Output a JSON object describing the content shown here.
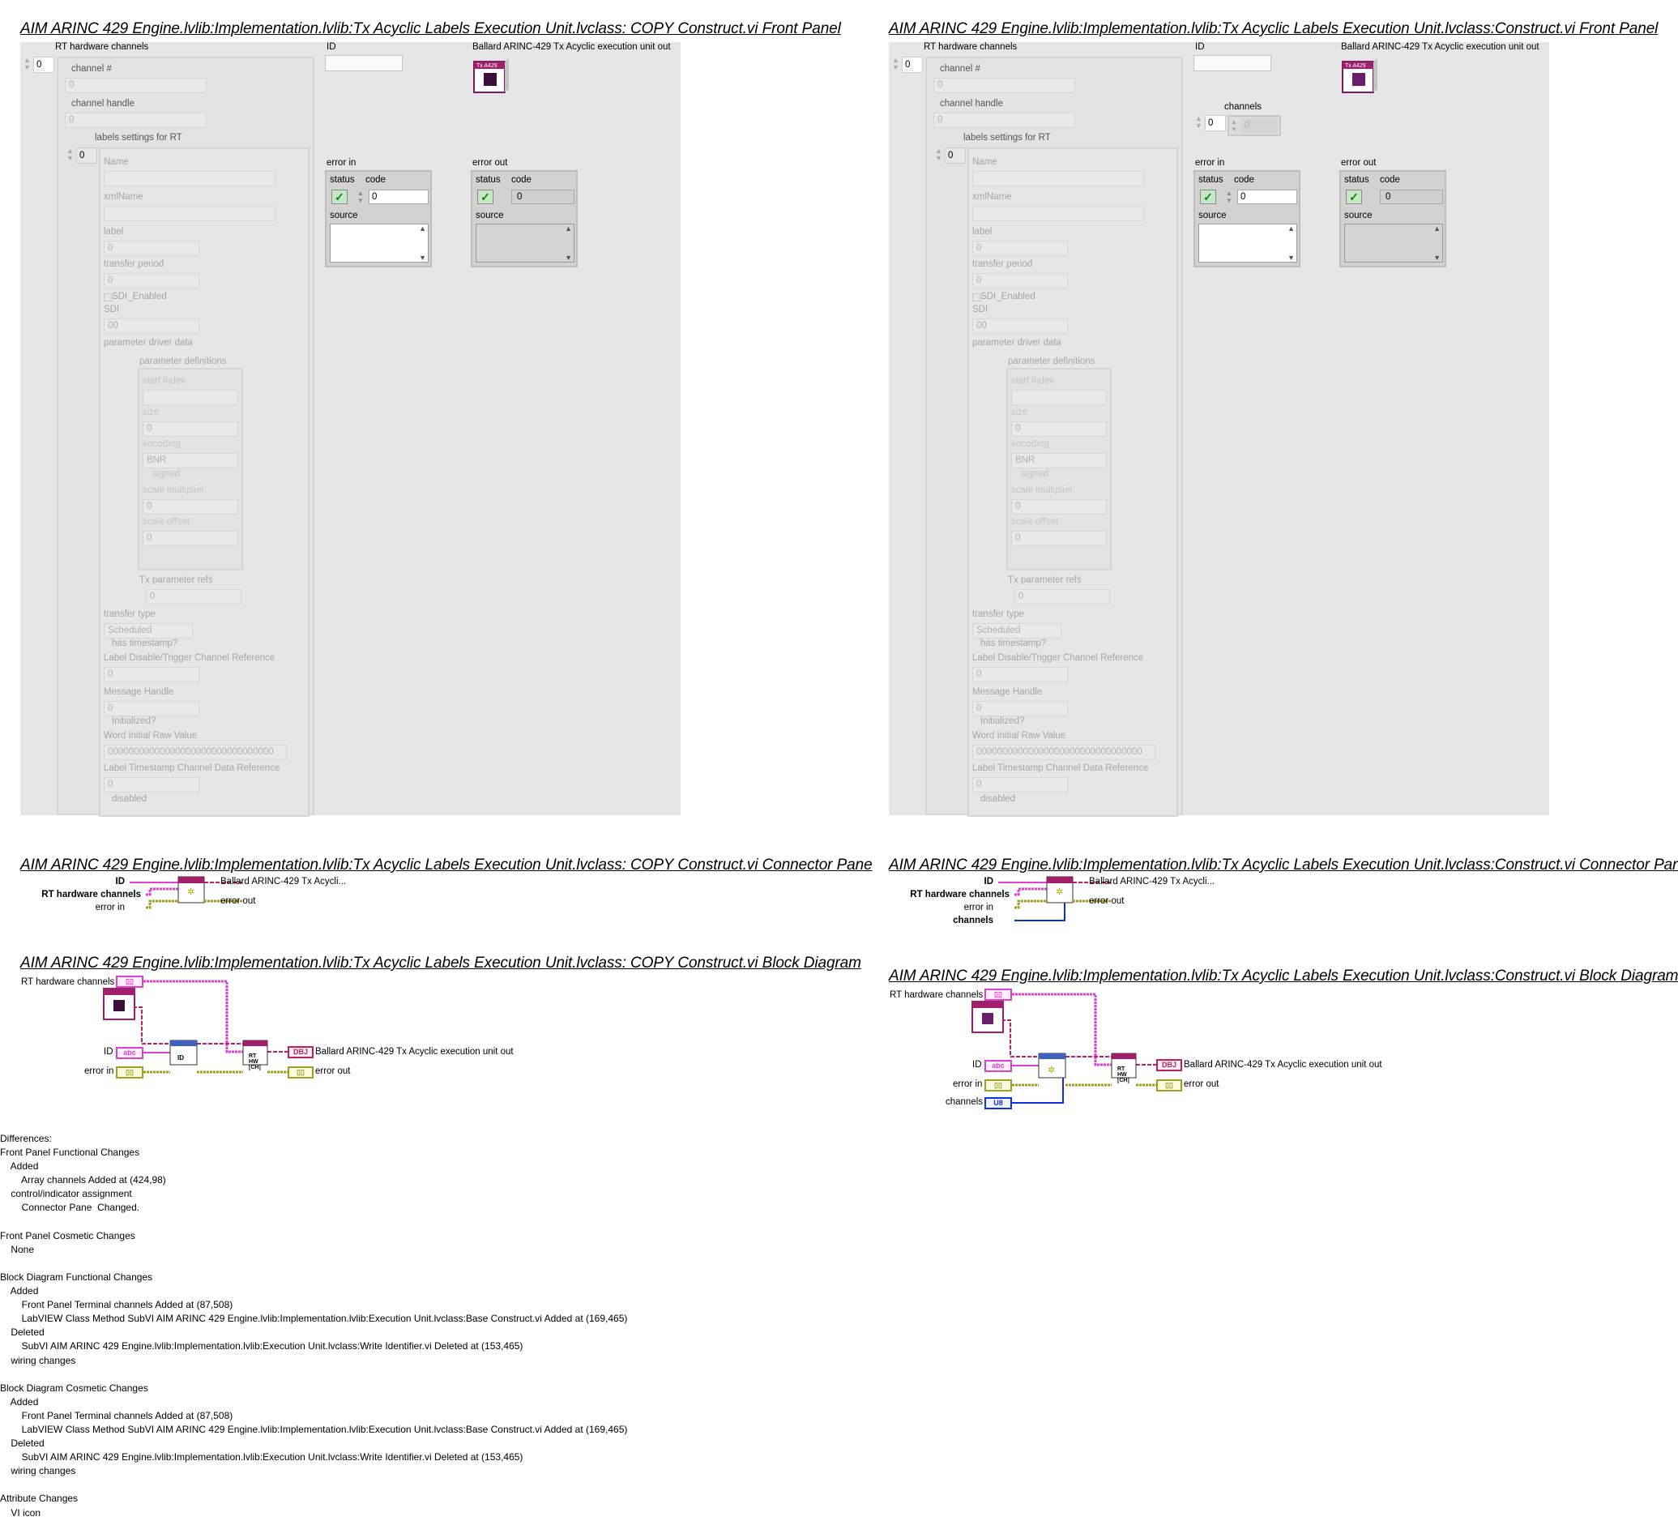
{
  "left": {
    "fp_title": "AIM ARINC 429 Engine.lvlib:Implementation.lvlib:Tx Acyclic Labels Execution Unit.lvclass:  COPY  Construct.vi Front Panel",
    "cp_title": "AIM ARINC 429 Engine.lvlib:Implementation.lvlib:Tx Acyclic Labels Execution Unit.lvclass:  COPY  Construct.vi Connector Pane",
    "bd_title": "AIM ARINC 429 Engine.lvlib:Implementation.lvlib:Tx Acyclic Labels Execution Unit.lvclass:  COPY  Construct.vi Block Diagram"
  },
  "right": {
    "fp_title": "AIM ARINC 429 Engine.lvlib:Implementation.lvlib:Tx Acyclic Labels Execution Unit.lvclass:Construct.vi Front Panel",
    "cp_title": "AIM ARINC 429 Engine.lvlib:Implementation.lvlib:Tx Acyclic Labels Execution Unit.lvclass:Construct.vi Connector Pane",
    "bd_title": "AIM ARINC 429 Engine.lvlib:Implementation.lvlib:Tx Acyclic Labels Execution Unit.lvclass:Construct.vi Block Diagram"
  },
  "fp": {
    "rt_hw": "RT hardware channels",
    "id": "ID",
    "ballard": "Ballard ARINC-429 Tx Acyclic execution unit out",
    "channels": "channels",
    "index_zero": "0",
    "channel_num": "channel #",
    "channel_handle": "channel handle",
    "labels_settings": "labels settings for RT",
    "name": "Name",
    "xmlname": "xmlName",
    "label": "label",
    "transfer_period": "transfer period",
    "sdi_enabled": "SDI_Enabled",
    "sdi": "SDI",
    "sdi_val": "00",
    "param_driver": "parameter driver data",
    "param_defs": "parameter definitions",
    "start_index": "start index",
    "size": "size",
    "encoding": "encoding",
    "encoding_val": "BNR",
    "signed": "signed",
    "scale_mult": "scale multiplier",
    "scale_offset": "scale offset",
    "tx_param_refs": "Tx parameter refs",
    "transfer_type": "transfer type",
    "transfer_type_val": "Scheduled",
    "has_timestamp": "has timestamp?",
    "label_disable": "Label Disable/Trigger Channel Reference",
    "message_handle": "Message Handle",
    "initialized": "Initialized?",
    "word_initial": "Word Initial Raw Value",
    "word_initial_val": "00000000000000000000000000000000",
    "label_timestamp": "Label Timestamp Channel Data Reference",
    "disabled": "disabled",
    "error_in": "error in",
    "error_out": "error out",
    "status": "status",
    "code": "code",
    "source": "source",
    "icon_text": "Tx A429"
  },
  "cp": {
    "id": "ID",
    "rt_hw": "RT hardware channels",
    "error_in": "error in",
    "channels": "channels",
    "ballard_short": "Ballard ARINC-429 Tx Acycli...",
    "error_out": "error out"
  },
  "bd": {
    "rt_hw": "RT hardware channels",
    "id": "ID",
    "error_in": "error in",
    "channels": "channels",
    "ballard": "Ballard ARINC-429 Tx Acyclic execution unit out",
    "error_out": "error out",
    "abc": "abc",
    "obj": "DBJ",
    "u8": "U8",
    "node_id": "ID",
    "rt_node": "RT HW [CH]"
  },
  "diff_lines": [
    "Differences:",
    "Front Panel Functional Changes",
    "    Added",
    "        Array channels Added at (424,98)",
    "    control/indicator assignment",
    "        Connector Pane  Changed.",
    "",
    "Front Panel Cosmetic Changes",
    "    None",
    "",
    "Block Diagram Functional Changes",
    "    Added",
    "        Front Panel Terminal channels Added at (87,508)",
    "        LabVIEW Class Method SubVI AIM ARINC 429 Engine.lvlib:Implementation.lvlib:Execution Unit.lvclass:Base Construct.vi Added at (169,465)",
    "    Deleted",
    "        SubVI AIM ARINC 429 Engine.lvlib:Implementation.lvlib:Execution Unit.lvclass:Write Identifier.vi Deleted at (153,465)",
    "    wiring changes",
    "",
    "Block Diagram Cosmetic Changes",
    "    Added",
    "        Front Panel Terminal channels Added at (87,508)",
    "        LabVIEW Class Method SubVI AIM ARINC 429 Engine.lvlib:Implementation.lvlib:Execution Unit.lvclass:Base Construct.vi Added at (169,465)",
    "    Deleted",
    "        SubVI AIM ARINC 429 Engine.lvlib:Implementation.lvlib:Execution Unit.lvclass:Write Identifier.vi Deleted at (153,465)",
    "    wiring changes",
    "",
    "Attribute Changes",
    "    VI icon"
  ]
}
